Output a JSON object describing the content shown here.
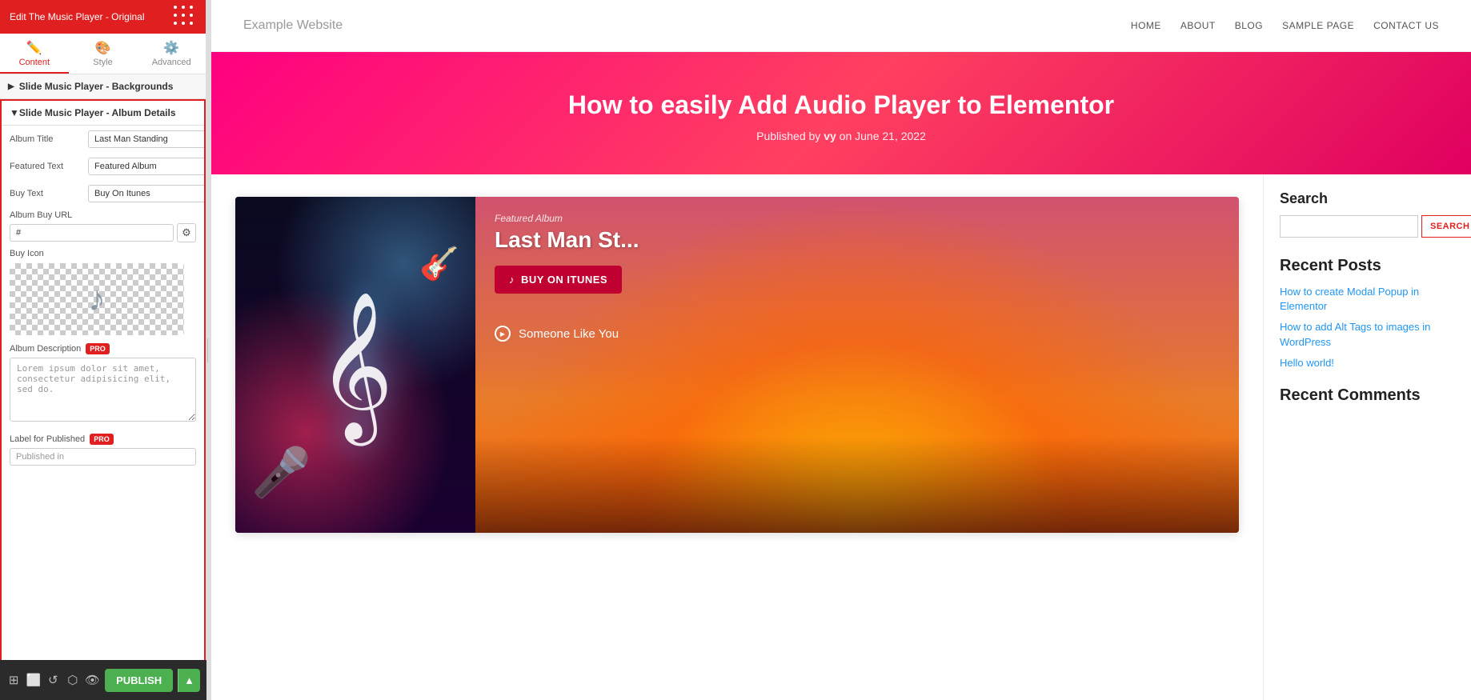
{
  "topbar": {
    "title": "Edit The Music Player - Original"
  },
  "tabs": [
    {
      "label": "Content",
      "icon": "✏️",
      "active": true
    },
    {
      "label": "Style",
      "icon": "🎨",
      "active": false
    },
    {
      "label": "Advanced",
      "icon": "⚙️",
      "active": false
    }
  ],
  "sections": {
    "backgrounds": {
      "label": "Slide Music Player - Backgrounds",
      "collapsed": true
    },
    "albumDetails": {
      "label": "Slide Music Player - Album Details",
      "collapsed": false
    }
  },
  "form": {
    "albumTitle": {
      "label": "Album Title",
      "value": "Last Man Standing"
    },
    "featuredText": {
      "label": "Featured Text",
      "value": "Featured Album"
    },
    "buyText": {
      "label": "Buy Text",
      "value": "Buy On Itunes"
    },
    "albumBuyUrl": {
      "label": "Album Buy URL",
      "value": "#"
    },
    "buyIcon": {
      "label": "Buy Icon"
    },
    "albumDescription": {
      "label": "Album Description",
      "placeholder": "Lorem ipsum dolor sit amet, consectetur adipisicing elit, sed do."
    },
    "labelForPublished": {
      "label": "Label for Published",
      "placeholder": "Published in"
    }
  },
  "website": {
    "brand": "Example Website",
    "navLinks": [
      "HOME",
      "ABOUT",
      "BLOG",
      "SAMPLE PAGE",
      "CONTACT US"
    ],
    "hero": {
      "title": "How to easily Add Audio Player to Elementor",
      "subtitle": "Published by ",
      "author": "vy",
      "date": "June 21, 2022"
    }
  },
  "musicPlayer": {
    "featuredText": "Featured Album",
    "albumName": "Last Man St...",
    "buyButtonLabel": "BUY ON ITUNES",
    "trackName": "Someone Like You"
  },
  "sidebar": {
    "searchLabel": "Search",
    "searchPlaceholder": "",
    "searchButtonLabel": "SEARCH",
    "recentPostsTitle": "Recent Posts",
    "posts": [
      "How to create Modal Popup in Elementor",
      "How to add Alt Tags to images in WordPress",
      "Hello world!"
    ],
    "recentCommentsTitle": "Recent Comments"
  },
  "bottomToolbar": {
    "publishLabel": "PUBLISH"
  }
}
